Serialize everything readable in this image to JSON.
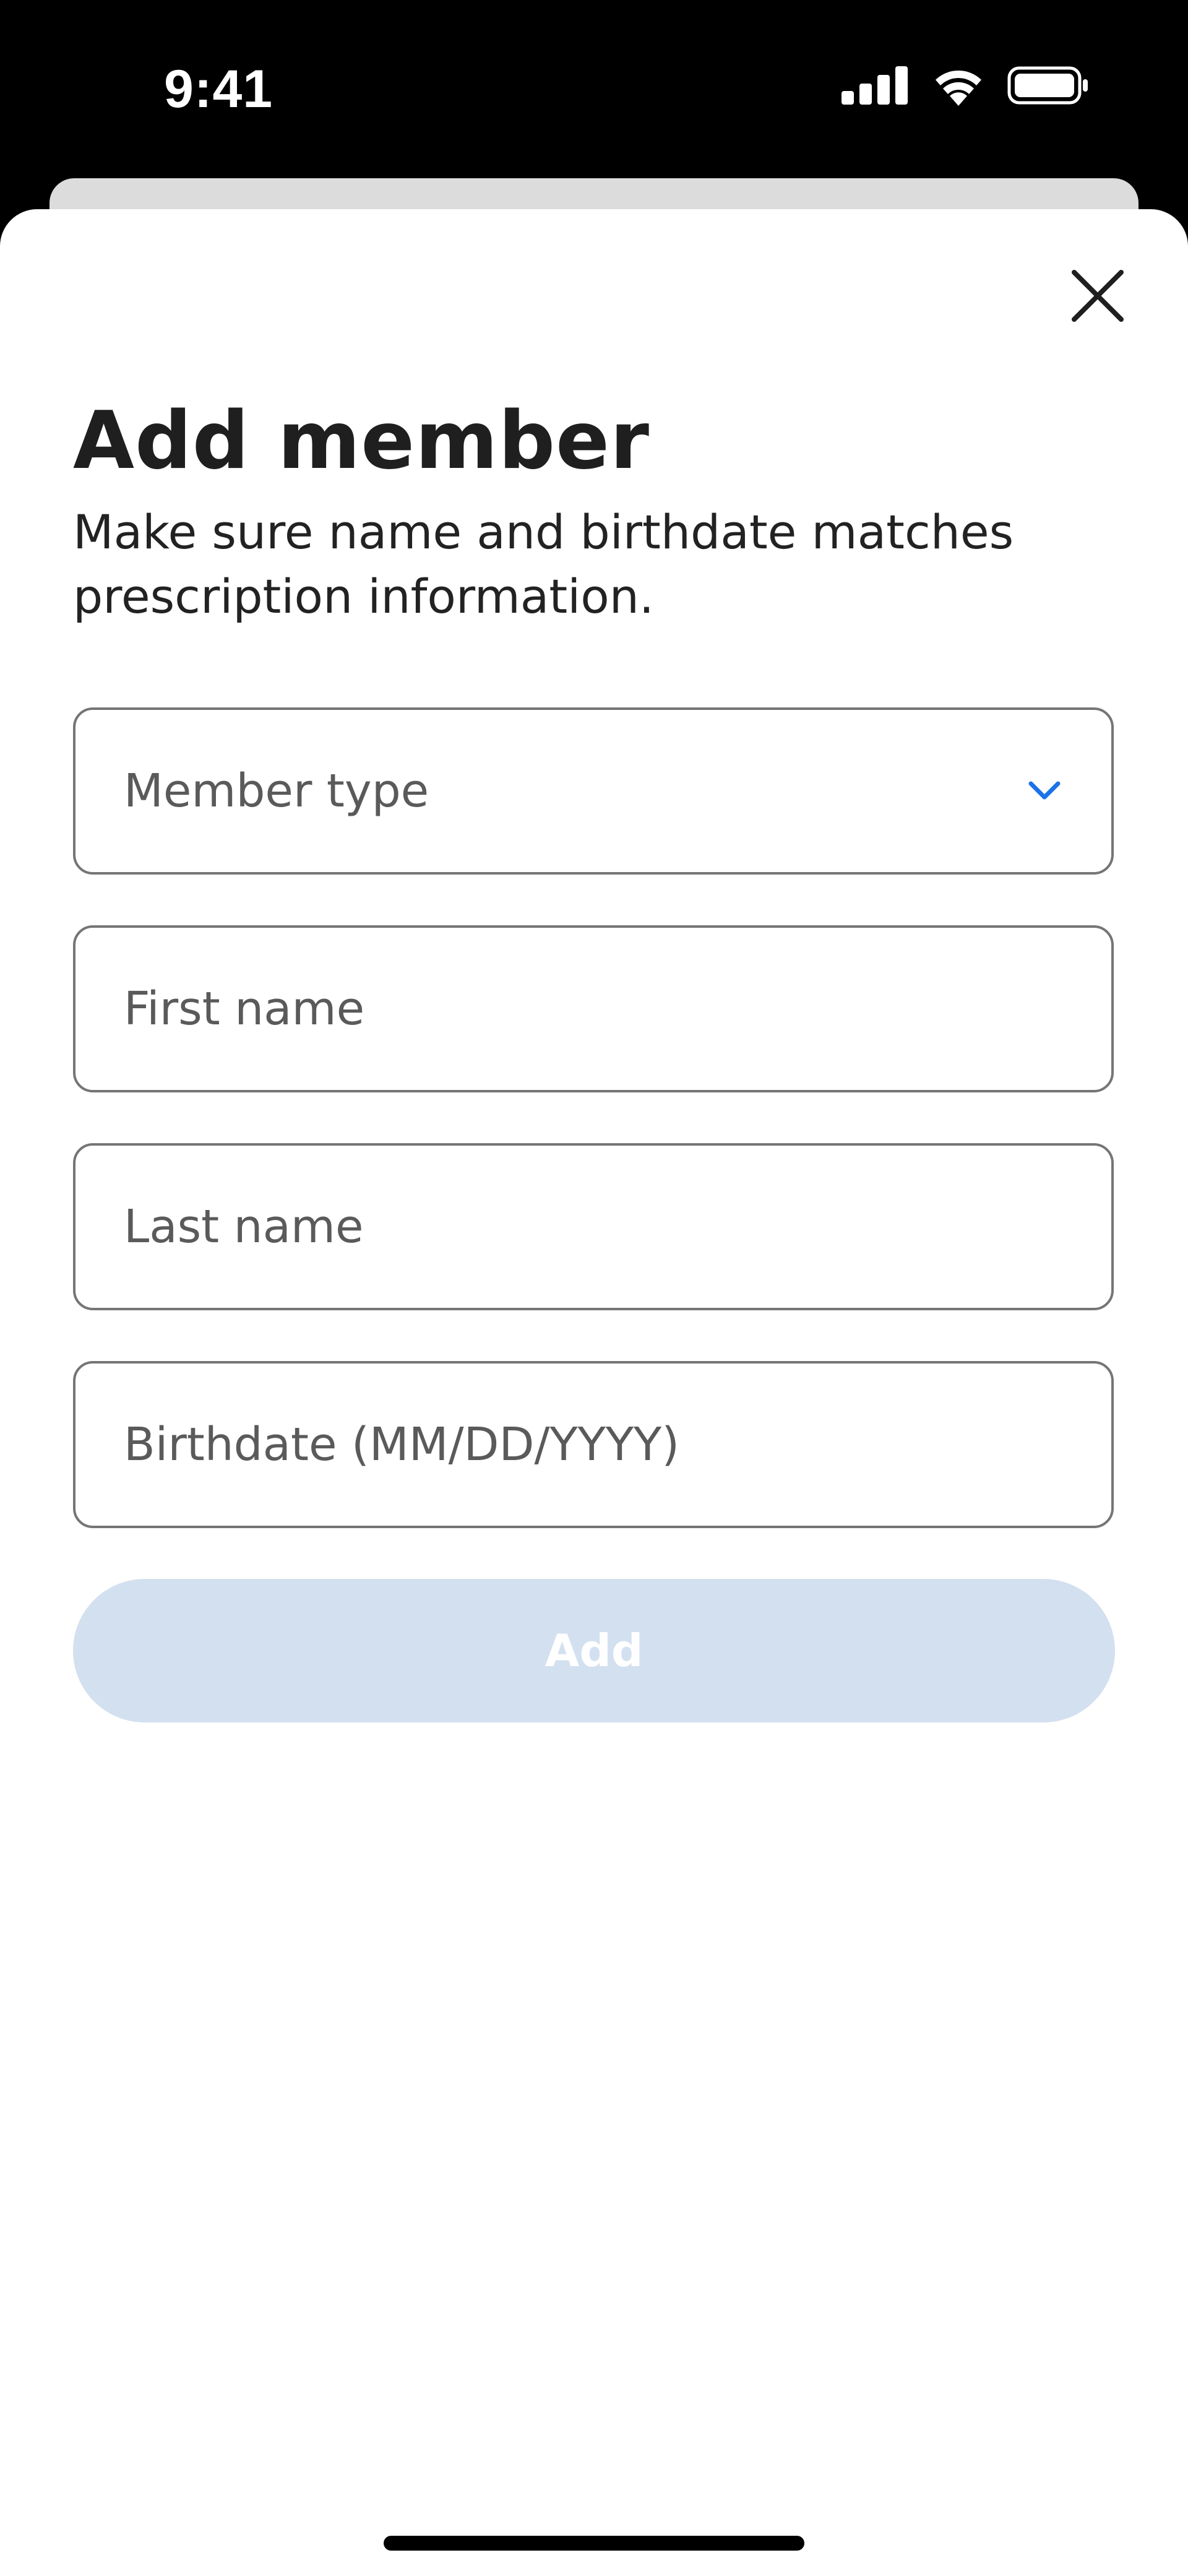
{
  "status_bar": {
    "time": "9:41",
    "icons": [
      "cellular-signal-icon",
      "wifi-icon",
      "battery-icon"
    ]
  },
  "sheet": {
    "close_icon": "close-icon",
    "title": "Add member",
    "subtitle": "Make sure name and birthdate matches prescription information."
  },
  "form": {
    "member_type": {
      "label": "Member type",
      "icon": "chevron-down-icon"
    },
    "first_name": {
      "placeholder": "First name",
      "value": ""
    },
    "last_name": {
      "placeholder": "Last name",
      "value": ""
    },
    "birthdate": {
      "placeholder": "Birthdate (MM/DD/YYYY)",
      "value": ""
    },
    "add_button": {
      "label": "Add",
      "enabled": false
    }
  },
  "colors": {
    "accent": "#1a73e8",
    "button_disabled_bg": "#d3e0ef",
    "border": "#757575",
    "card_peek": "#dcdcdc"
  }
}
